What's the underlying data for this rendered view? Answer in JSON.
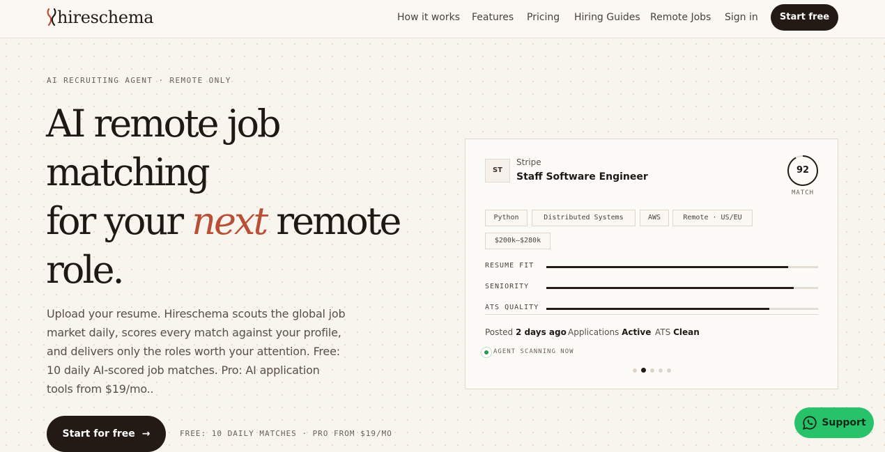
{
  "header": {
    "brand": "hireschema",
    "nav": [
      "How it works",
      "Features",
      "Pricing",
      "Hiring Guides",
      "Remote Jobs",
      "Sign in"
    ],
    "cta": "Start free"
  },
  "hero": {
    "eyebrow": "AI RECRUITING AGENT · REMOTE ONLY",
    "title_line1": "AI remote job matching",
    "title_line2_a": "for your ",
    "title_accent": "next",
    "title_line2_b": " remote role.",
    "description": "Upload your resume. Hireschema scouts the global job market daily, scores every match against your profile, and delivers only the roles worth your attention. Free: 10 daily AI-scored job matches. Pro: AI application tools from $19/mo..",
    "cta": "Start for free",
    "cta_arrow": "→",
    "cta_note": "FREE: 10 DAILY MATCHES · PRO FROM $19/MO"
  },
  "card": {
    "company_initials": "ST",
    "company": "Stripe",
    "job_title": "Staff Software Engineer",
    "score": "92",
    "score_label": "MATCH",
    "tags": [
      "Python",
      "Distributed Systems",
      "AWS",
      "Remote · US/EU",
      "$200k–$280k"
    ],
    "metrics": [
      {
        "label": "RESUME FIT",
        "value": 0.89
      },
      {
        "label": "SENIORITY",
        "value": 0.91
      },
      {
        "label": "ATS QUALITY",
        "value": 0.82
      }
    ],
    "meta": {
      "posted_label": "Posted",
      "posted_value": "2 days ago",
      "applications_label": "Applications",
      "applications_value": "Active",
      "ats_label": "ATS",
      "ats_value": "Clean"
    },
    "scan_text": "AGENT SCANNING NOW",
    "carousel_active": 2,
    "carousel_count": 5
  },
  "support": {
    "label": "Support"
  },
  "colors": {
    "accent": "#b94f34",
    "dark": "#231915",
    "support": "#27c26a",
    "live": "#2b9a4b"
  },
  "icons": {
    "logo": "hireschema-logo-mark",
    "arrow": "arrow-right-icon",
    "support": "whatsapp-icon",
    "scan": "live-dot-icon"
  }
}
